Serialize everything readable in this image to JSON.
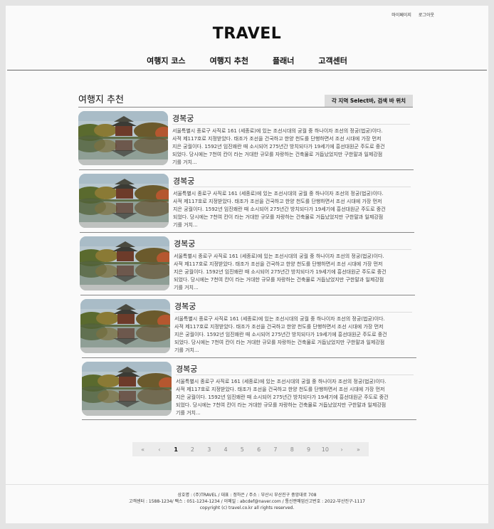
{
  "header": {
    "links": [
      "마이페이지",
      "로그아웃"
    ],
    "logo": "TRAVEL",
    "nav": [
      "여행지 코스",
      "여행지 추천",
      "플래너",
      "고객센터"
    ]
  },
  "main": {
    "title": "여행지 추천",
    "region_select_label": "각 지역 Select바, 검색 바 위치",
    "items": [
      {
        "title": "경복궁",
        "description": "서울특별시 종로구 사직로 161 (세종로)에 있는 조선시대의 궁궐 중 하나이자 조선의 정궁(법궁)이다. 사적 제117호로 지정받았다. 태조가 조선을 건국하고 한양 천도를 단행하면서 조선 시대에 가장 먼저 지은 궁궐이다. 1592년 임진왜란 때 소시되어 275년간 방치되다가 19세기에 흥선대원군 주도로 중건되었다. 당시에는 7천여 칸이 라는 거대한 규모를 자랑하는 건축물로 거듭났었지만 구한말과 일제강점기를 거치..."
      },
      {
        "title": "경복궁",
        "description": "서울특별시 종로구 사직로 161 (세종로)에 있는 조선시대의 궁궐 중 하나이자 조선의 정궁(법궁)이다. 사적 제117호로 지정받았다. 태조가 조선을 건국하고 한양 천도를 단행하면서 조선 시대에 가장 먼저 지은 궁궐이다. 1592년 임진왜란 때 소시되어 275년간 방치되다가 19세기에 흥선대원군 주도로 중건되었다. 당시에는 7천여 칸이 라는 거대한 규모를 자랑하는 건축물로 거듭났었지만 구한말과 일제강점기를 거치..."
      },
      {
        "title": "경복궁",
        "description": "서울특별시 종로구 사직로 161 (세종로)에 있는 조선시대의 궁궐 중 하나이자 조선의 정궁(법궁)이다. 사적 제117호로 지정받았다. 태조가 조선을 건국하고 한양 천도를 단행하면서 조선 시대에 가장 먼저 지은 궁궐이다. 1592년 임진왜란 때 소시되어 275년간 방치되다가 19세기에 흥선대원군 주도로 중건되었다. 당시에는 7천여 칸이 라는 거대한 규모를 자랑하는 건축물로 거듭났었지만 구한말과 일제강점기를 거치..."
      },
      {
        "title": "경복궁",
        "description": "서울특별시 종로구 사직로 161 (세종로)에 있는 조선시대의 궁궐 중 하나이자 조선의 정궁(법궁)이다. 사적 제117호로 지정받았다. 태조가 조선을 건국하고 한양 천도를 단행하면서 조선 시대에 가장 먼저 지은 궁궐이다. 1592년 임진왜란 때 소시되어 275년간 방치되다가 19세기에 흥선대원군 주도로 중건되었다. 당시에는 7천여 칸이 라는 거대한 규모를 자랑하는 건축물로 거듭났었지만 구한말과 일제강점기를 거치..."
      },
      {
        "title": "경복궁",
        "description": "서울특별시 종로구 사직로 161 (세종로)에 있는 조선시대의 궁궐 중 하나이자 조선의 정궁(법궁)이다. 사적 제117호로 지정받았다. 태조가 조선을 건국하고 한양 천도를 단행하면서 조선 시대에 가장 먼저 지은 궁궐이다. 1592년 임진왜란 때 소시되어 275년간 방치되다가 19세기에 흥선대원군 주도로 중건되었다. 당시에는 7천여 칸이 라는 거대한 규모를 자랑하는 건축물로 거듭났었지만 구한말과 일제강점기를 거치..."
      }
    ]
  },
  "pagination": {
    "first": "«",
    "prev": "‹",
    "pages": [
      "1",
      "2",
      "3",
      "4",
      "5",
      "6",
      "7",
      "8",
      "9",
      "10"
    ],
    "active": "1",
    "next": "›",
    "last": "»"
  },
  "footer": {
    "line1": "상호명 : (주)TRAVEL / 대표 : 정하은 / 주소 : 부산시 부산진구 중앙대로 708",
    "line2": "고객센터 : 1588-1234/ 팩스 : 051-1234-1234 / 이메일 : abcdef@naver.com / 통신판매업신고번호 : 2022-부산진구-1117",
    "line3": "copyright (c) travel.co.kr all rights reserved."
  },
  "colors": {
    "accent": "#dcdcdc",
    "rule": "#888888"
  },
  "icons": {
    "thumbnail": "palace-pond-photo"
  }
}
